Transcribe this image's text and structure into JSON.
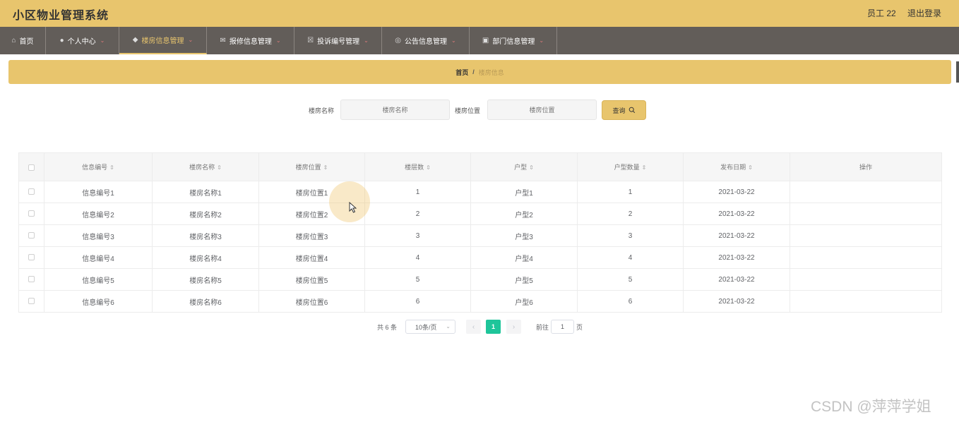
{
  "header": {
    "title": "小区物业管理系统",
    "user": "员工 22",
    "logout": "退出登录"
  },
  "nav": {
    "items": [
      {
        "icon": "home-icon",
        "label": "首页",
        "dropdown": false
      },
      {
        "icon": "user-icon",
        "label": "个人中心",
        "dropdown": true
      },
      {
        "icon": "building-icon",
        "label": "楼房信息管理",
        "dropdown": true,
        "active": true
      },
      {
        "icon": "mail-icon",
        "label": "报修信息管理",
        "dropdown": true
      },
      {
        "icon": "complaint-icon",
        "label": "投诉编号管理",
        "dropdown": true
      },
      {
        "icon": "notice-icon",
        "label": "公告信息管理",
        "dropdown": true
      },
      {
        "icon": "department-icon",
        "label": "部门信息管理",
        "dropdown": true
      }
    ]
  },
  "breadcrumb": {
    "home": "首页",
    "separator": "/",
    "current": "楼房信息"
  },
  "search": {
    "name_label": "楼房名称",
    "name_placeholder": "楼房名称",
    "location_label": "楼房位置",
    "location_placeholder": "楼房位置",
    "query_button": "查询"
  },
  "table": {
    "columns": [
      "信息编号",
      "楼房名称",
      "楼房位置",
      "楼层数",
      "户型",
      "户型数量",
      "发布日期",
      "操作"
    ],
    "rows": [
      {
        "id": "信息编号1",
        "name": "楼房名称1",
        "location": "楼房位置1",
        "floors": "1",
        "type": "户型1",
        "count": "1",
        "date": "2021-03-22",
        "action": ""
      },
      {
        "id": "信息编号2",
        "name": "楼房名称2",
        "location": "楼房位置2",
        "floors": "2",
        "type": "户型2",
        "count": "2",
        "date": "2021-03-22",
        "action": ""
      },
      {
        "id": "信息编号3",
        "name": "楼房名称3",
        "location": "楼房位置3",
        "floors": "3",
        "type": "户型3",
        "count": "3",
        "date": "2021-03-22",
        "action": ""
      },
      {
        "id": "信息编号4",
        "name": "楼房名称4",
        "location": "楼房位置4",
        "floors": "4",
        "type": "户型4",
        "count": "4",
        "date": "2021-03-22",
        "action": ""
      },
      {
        "id": "信息编号5",
        "name": "楼房名称5",
        "location": "楼房位置5",
        "floors": "5",
        "type": "户型5",
        "count": "5",
        "date": "2021-03-22",
        "action": ""
      },
      {
        "id": "信息编号6",
        "name": "楼房名称6",
        "location": "楼房位置6",
        "floors": "6",
        "type": "户型6",
        "count": "6",
        "date": "2021-03-22",
        "action": ""
      }
    ]
  },
  "pagination": {
    "total": "共 6 条",
    "page_size": "10条/页",
    "prev": "‹",
    "current_page": "1",
    "next": "›",
    "goto_label": "前往",
    "goto_value": "1",
    "page_suffix": "页"
  },
  "watermark": "CSDN @萍萍学姐",
  "colors": {
    "topbar": "#e8c56d",
    "navbar": "#625d59",
    "accent": "#e8c56d",
    "pager_active": "#1ec59a"
  }
}
